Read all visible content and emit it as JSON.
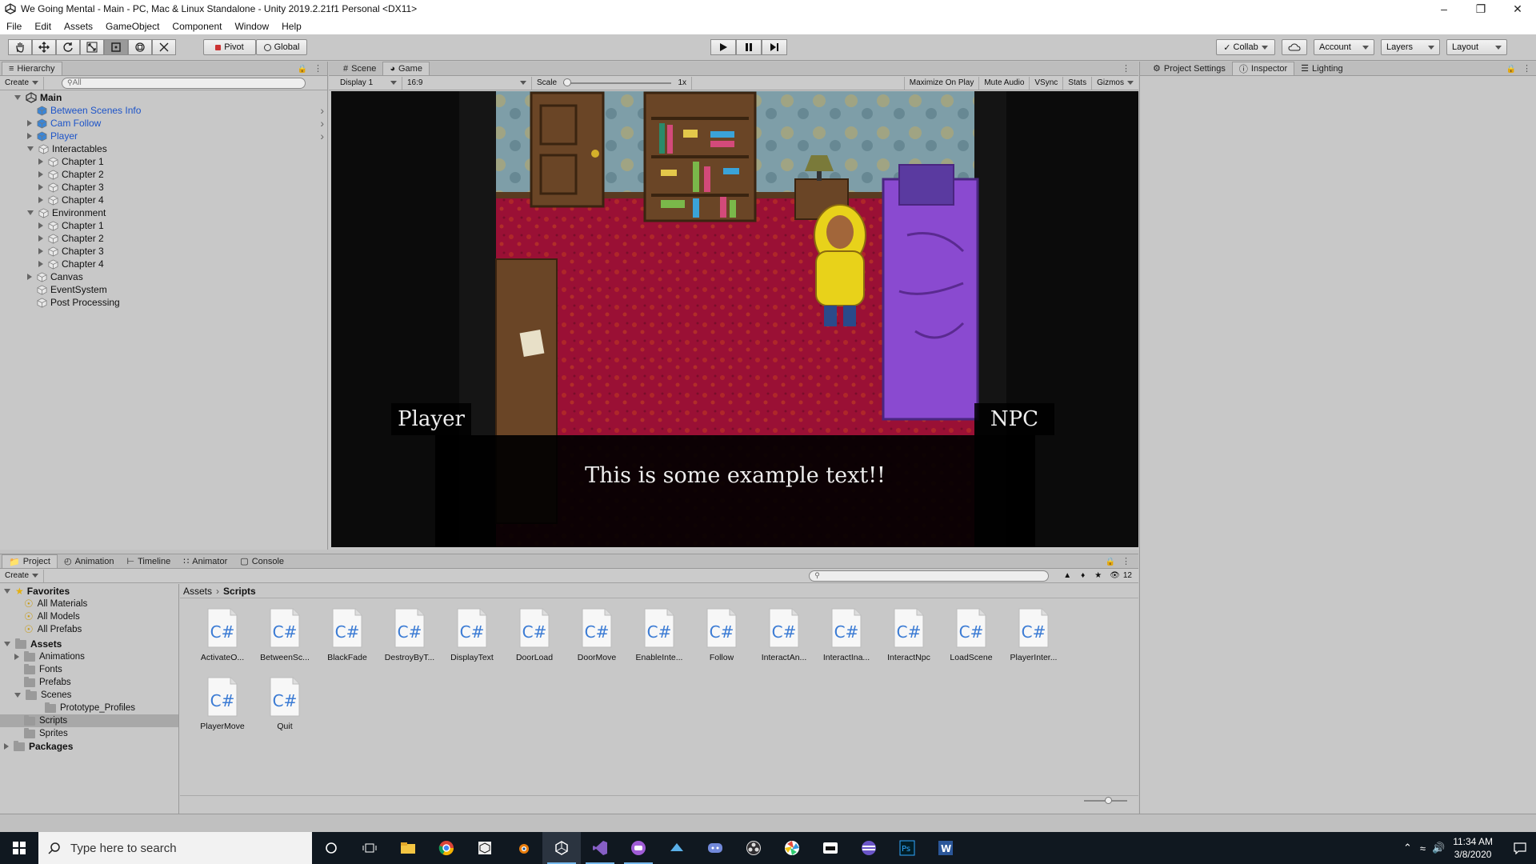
{
  "window": {
    "title": "We Going Mental - Main - PC, Mac & Linux Standalone - Unity 2019.2.21f1 Personal <DX11>"
  },
  "menu": [
    "File",
    "Edit",
    "Assets",
    "GameObject",
    "Component",
    "Window",
    "Help"
  ],
  "toolbar": {
    "pivot": "Pivot",
    "global": "Global",
    "collab": "Collab",
    "account": "Account",
    "layers": "Layers",
    "layout": "Layout"
  },
  "hierarchy": {
    "tab": "Hierarchy",
    "create": "Create",
    "search_placeholder": "All",
    "scene": "Main",
    "items": [
      {
        "label": "Between Scenes Info",
        "depth": 1,
        "prefab": true,
        "arrow": "none"
      },
      {
        "label": "Cam Follow",
        "depth": 1,
        "prefab": true,
        "arrow": "right"
      },
      {
        "label": "Player",
        "depth": 1,
        "prefab": true,
        "arrow": "right"
      },
      {
        "label": "Interactables",
        "depth": 1,
        "prefab": false,
        "arrow": "down"
      },
      {
        "label": "Chapter 1",
        "depth": 2,
        "prefab": false,
        "arrow": "right"
      },
      {
        "label": "Chapter 2",
        "depth": 2,
        "prefab": false,
        "arrow": "right"
      },
      {
        "label": "Chapter 3",
        "depth": 2,
        "prefab": false,
        "arrow": "right"
      },
      {
        "label": "Chapter 4",
        "depth": 2,
        "prefab": false,
        "arrow": "right"
      },
      {
        "label": "Environment",
        "depth": 1,
        "prefab": false,
        "arrow": "down"
      },
      {
        "label": "Chapter 1",
        "depth": 2,
        "prefab": false,
        "arrow": "right"
      },
      {
        "label": "Chapter 2",
        "depth": 2,
        "prefab": false,
        "arrow": "right"
      },
      {
        "label": "Chapter 3",
        "depth": 2,
        "prefab": false,
        "arrow": "right"
      },
      {
        "label": "Chapter 4",
        "depth": 2,
        "prefab": false,
        "arrow": "right"
      },
      {
        "label": "Canvas",
        "depth": 1,
        "prefab": false,
        "arrow": "right"
      },
      {
        "label": "EventSystem",
        "depth": 1,
        "prefab": false,
        "arrow": "none"
      },
      {
        "label": "Post Processing",
        "depth": 1,
        "prefab": false,
        "arrow": "none"
      }
    ]
  },
  "game_view": {
    "tabs": [
      "Scene",
      "Game"
    ],
    "display": "Display 1",
    "aspect": "16:9",
    "scale_label": "Scale",
    "scale_value": "1x",
    "options": [
      "Maximize On Play",
      "Mute Audio",
      "VSync",
      "Stats",
      "Gizmos"
    ],
    "speaker_left": "Player",
    "speaker_right": "NPC",
    "dialogue": "This is some example text!!"
  },
  "inspector": {
    "tabs": [
      "Project Settings",
      "Inspector",
      "Lighting"
    ]
  },
  "project": {
    "tabs": [
      "Project",
      "Animation",
      "Timeline",
      "Animator",
      "Console"
    ],
    "create": "Create",
    "hidden_count": "12",
    "favorites_label": "Favorites",
    "favorites": [
      "All Materials",
      "All Models",
      "All Prefabs"
    ],
    "assets_label": "Assets",
    "folders": [
      {
        "label": "Animations",
        "depth": 1,
        "arrow": "right"
      },
      {
        "label": "Fonts",
        "depth": 1,
        "arrow": "none"
      },
      {
        "label": "Prefabs",
        "depth": 1,
        "arrow": "none"
      },
      {
        "label": "Scenes",
        "depth": 1,
        "arrow": "down"
      },
      {
        "label": "Prototype_Profiles",
        "depth": 2,
        "arrow": "none"
      },
      {
        "label": "Scripts",
        "depth": 1,
        "arrow": "none",
        "selected": true
      },
      {
        "label": "Sprites",
        "depth": 1,
        "arrow": "none"
      }
    ],
    "packages_label": "Packages",
    "breadcrumb": [
      "Assets",
      "Scripts"
    ],
    "scripts": [
      "ActivateO...",
      "BetweenSc...",
      "BlackFade",
      "DestroyByT...",
      "DisplayText",
      "DoorLoad",
      "DoorMove",
      "EnableInte...",
      "Follow",
      "InteractAn...",
      "InteractIna...",
      "InteractNpc",
      "LoadScene",
      "PlayerInter...",
      "PlayerMove",
      "Quit"
    ],
    "script_icon_text": "C#"
  },
  "taskbar": {
    "search_placeholder": "Type here to search",
    "time": "11:34 AM",
    "date": "3/8/2020"
  },
  "colors": {
    "accent": "#1d54c8",
    "taskbar": "#101820",
    "editor_bg": "#c2c2c2"
  }
}
